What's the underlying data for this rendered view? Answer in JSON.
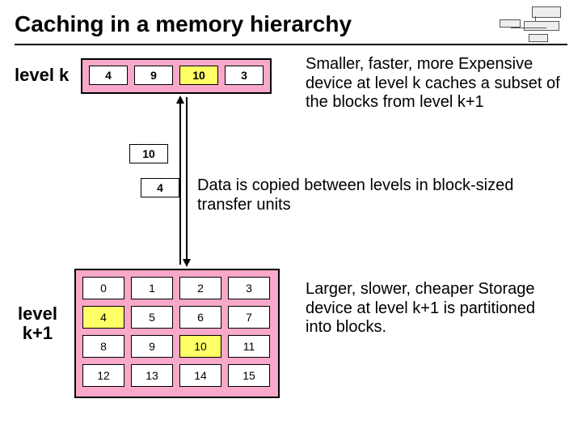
{
  "title": "Caching in a memory hierarchy",
  "labels": {
    "level_k": "level k",
    "level_k1_a": "level",
    "level_k1_b": "k+1"
  },
  "cache_k": [
    "4",
    "9",
    "10",
    "3"
  ],
  "cache_k_highlight_index": 2,
  "floating": {
    "up": "10",
    "down": "4"
  },
  "store_k1": [
    "0",
    "1",
    "2",
    "3",
    "4",
    "5",
    "6",
    "7",
    "8",
    "9",
    "10",
    "11",
    "12",
    "13",
    "14",
    "15"
  ],
  "store_k1_highlight": [
    4,
    10
  ],
  "paragraphs": {
    "p1": "Smaller, faster, more Expensive device at level k caches a subset of the blocks from level k+1",
    "p2": "Data is copied between levels in block-sized transfer units",
    "p3": "Larger, slower, cheaper Storage device at level k+1 is partitioned into blocks."
  }
}
